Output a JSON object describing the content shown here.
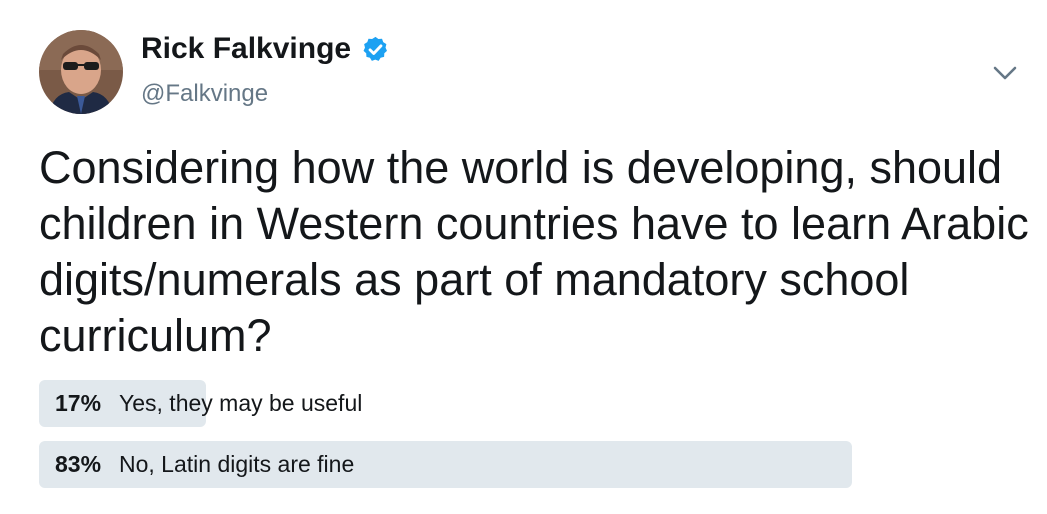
{
  "author": {
    "display_name": "Rick Falkvinge",
    "handle": "@Falkvinge",
    "verified_icon": "verified-badge-icon"
  },
  "tweet": {
    "text": "Considering how the world is developing, should children in Western countries have to learn Arabic digits/numerals as part of mandatory school curriculum?"
  },
  "poll": {
    "options": [
      {
        "percent_label": "17%",
        "label": "Yes, they may be useful",
        "fraction": 0.17
      },
      {
        "percent_label": "83%",
        "label": "No, Latin digits are fine",
        "fraction": 0.83
      }
    ]
  },
  "colors": {
    "verified_blue": "#1da1f2",
    "bar_fill": "#e1e8ed",
    "handle_gray": "#657786"
  }
}
